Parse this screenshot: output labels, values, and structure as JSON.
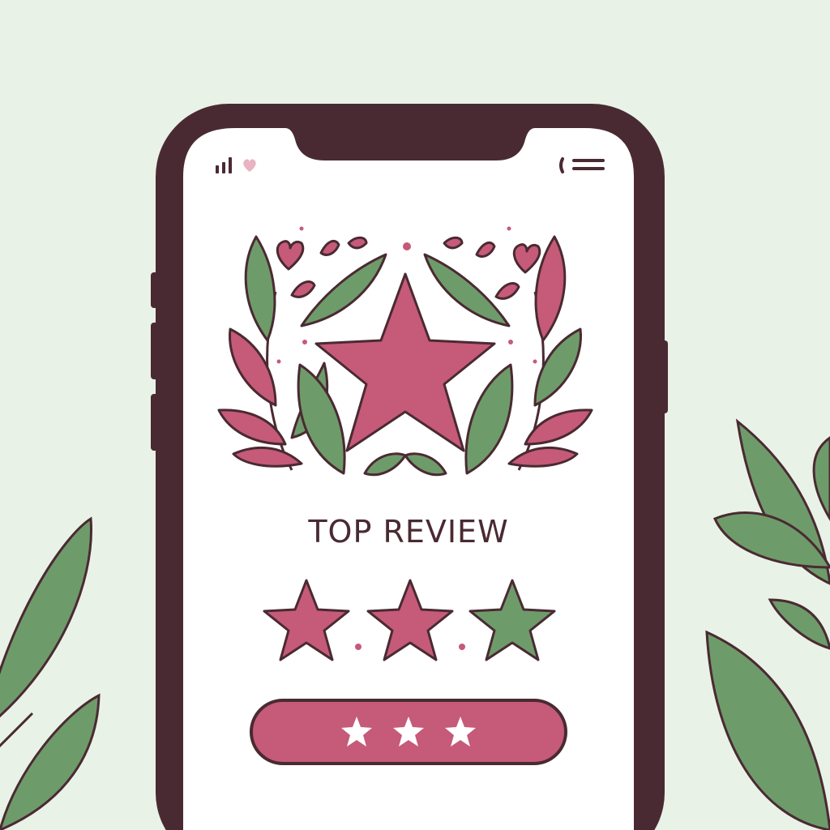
{
  "review": {
    "title": "TOP REVIEW",
    "rating_value": 2,
    "rating_max": 3
  },
  "status_bar": {
    "left_icons": [
      "signal-icon",
      "heart-icon"
    ],
    "right_icons": [
      "menu-icon"
    ]
  },
  "colors": {
    "background": "#e9f2e7",
    "phone_frame": "#4a2a32",
    "screen": "#ffffff",
    "accent_pink": "#c65a79",
    "leaf_green": "#6e9b6a"
  }
}
